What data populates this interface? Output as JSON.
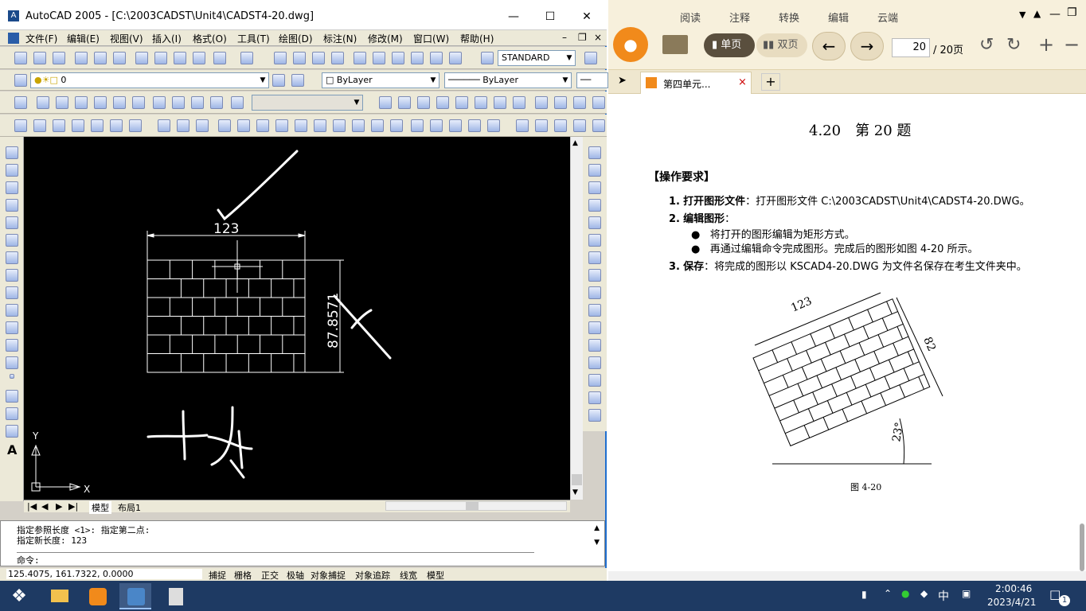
{
  "acad": {
    "title": "AutoCAD 2005 - [C:\\2003CADST\\Unit4\\CADST4-20.dwg]",
    "menu": [
      "文件(F)",
      "编辑(E)",
      "视图(V)",
      "插入(I)",
      "格式(O)",
      "工具(T)",
      "绘图(D)",
      "标注(N)",
      "修改(M)",
      "窗口(W)",
      "帮助(H)"
    ],
    "text_style": "STANDARD",
    "layer": "0",
    "color": "ByLayer",
    "linetype": "ByLayer",
    "dimension_top": "123",
    "dimension_right": "87.8571",
    "axis_x": "X",
    "axis_y": "Y",
    "handwriting": "土木",
    "tabs": [
      "模型",
      "布局1"
    ],
    "command_lines": [
      "指定参照长度 <1>:  指定第二点:",
      "指定新长度: 123"
    ],
    "command_prompt": "命令:",
    "coords": "125.4075, 161.7322, 0.0000",
    "status_toggles": [
      "捕捉",
      "栅格",
      "正交",
      "极轴",
      "对象捕捉",
      "对象追踪",
      "线宽",
      "模型"
    ]
  },
  "reader": {
    "ribbon_tabs": [
      "阅读",
      "注释",
      "转换",
      "编辑",
      "云端"
    ],
    "view_single": "单页",
    "view_double": "双页",
    "page_current": "20",
    "page_total": "/ 20页",
    "doc_tab": "第四单元...",
    "heading": "4.20　第 20 题",
    "req_title": "【操作要求】",
    "items": [
      {
        "num": "1.",
        "label": "打开图形文件",
        "text": "：打开图形文件 C:\\2003CADST\\Unit4\\CADST4-20.DWG。"
      },
      {
        "num": "2.",
        "label": "编辑图形",
        "text": "："
      }
    ],
    "bullets": [
      "将打开的图形编辑为矩形方式。",
      "再通过编辑命令完成图形。完成后的图形如图 4-20 所示。"
    ],
    "save": {
      "num": "3.",
      "label": "保存",
      "text": "：将完成的图形以 KSCAD4-20.DWG 为文件名保存在考生文件夹中。"
    },
    "fig_dim_top": "123",
    "fig_dim_side": "82",
    "fig_angle": "23°",
    "fig_caption": "图 4-20"
  },
  "taskbar": {
    "time": "2:00:46",
    "date": "2023/4/21",
    "ime": "中",
    "notify_count": "1"
  }
}
